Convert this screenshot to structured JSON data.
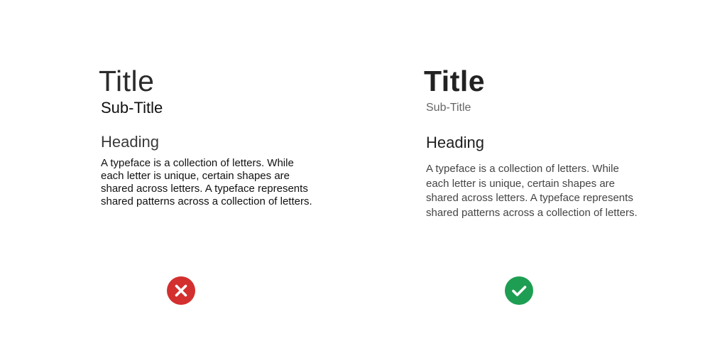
{
  "examples": {
    "wrong": {
      "title": "Title",
      "subtitle": "Sub-Title",
      "heading": "Heading",
      "body": "A typeface is a collection of letters. While each letter is unique, certain shapes are shared across letters. A typeface represents shared patterns across a collection of letters.",
      "indicator": {
        "icon": "cross-icon",
        "color": "#d32f2f"
      }
    },
    "right": {
      "title": "Title",
      "subtitle": "Sub-Title",
      "heading": "Heading",
      "body": "A typeface is a collection of letters. While each letter is unique, certain shapes are shared across letters. A typeface represents shared patterns across a collection of letters.",
      "indicator": {
        "icon": "check-icon",
        "color": "#1e9e52"
      }
    }
  }
}
